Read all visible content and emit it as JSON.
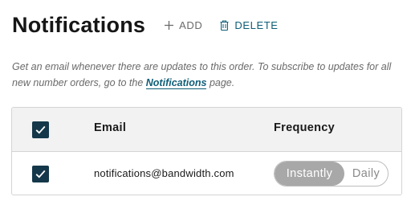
{
  "header": {
    "title": "Notifications",
    "add_label": "ADD",
    "delete_label": "DELETE"
  },
  "description": {
    "text_before": "Get an email whenever there are updates to this order. To subscribe to updates for all new number orders, go to the ",
    "link_text": "Notifications",
    "text_after": " page."
  },
  "table": {
    "columns": {
      "email": "Email",
      "frequency": "Frequency"
    },
    "rows": [
      {
        "email": "notifications@bandwidth.com",
        "frequency_options": [
          "Instantly",
          "Daily"
        ],
        "selected_frequency": "Instantly",
        "checked": true
      }
    ],
    "select_all_checked": true
  },
  "colors": {
    "accent": "#0f5e78",
    "checkbox": "#14384a",
    "toggle_active": "#a8a8a8"
  },
  "icons": {
    "add": "plus-icon",
    "delete": "trash-icon",
    "check": "check-icon"
  }
}
